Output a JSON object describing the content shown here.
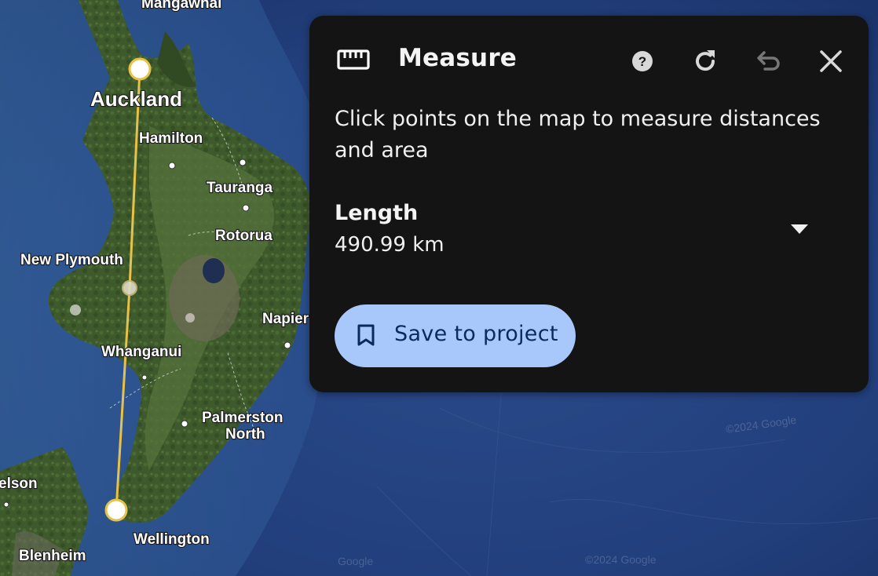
{
  "map": {
    "labels": {
      "mangawhai": "Mangawhai",
      "auckland": "Auckland",
      "hamilton": "Hamilton",
      "tauranga": "Tauranga",
      "rotorua": "Rotorua",
      "new_plymouth": "New Plymouth",
      "napier": "Napier",
      "whanganui": "Whanganui",
      "palmerston_north_1": "Palmerston",
      "palmerston_north_2": "North",
      "nelson": "elson",
      "wellington": "Wellington",
      "blenheim": "Blenheim"
    },
    "watermarks": [
      "©2024 Google",
      "©2024 Google",
      "Google"
    ],
    "measure_line_color": "#e6c24a"
  },
  "measure_panel": {
    "title": "Measure",
    "title_icon": "ruler-icon",
    "buttons": {
      "help_icon": "help-icon",
      "refresh_icon": "refresh-icon",
      "undo_icon": "undo-icon",
      "close_icon": "close-icon"
    },
    "description": "Click points on the map to measure distances and area",
    "metric": {
      "label": "Length",
      "value": "490.99 km",
      "dropdown_icon": "caret-down-icon"
    },
    "save_button": {
      "label": "Save to project",
      "icon": "bookmark-icon",
      "color": "#a8c7fa"
    },
    "background": "#141414"
  }
}
